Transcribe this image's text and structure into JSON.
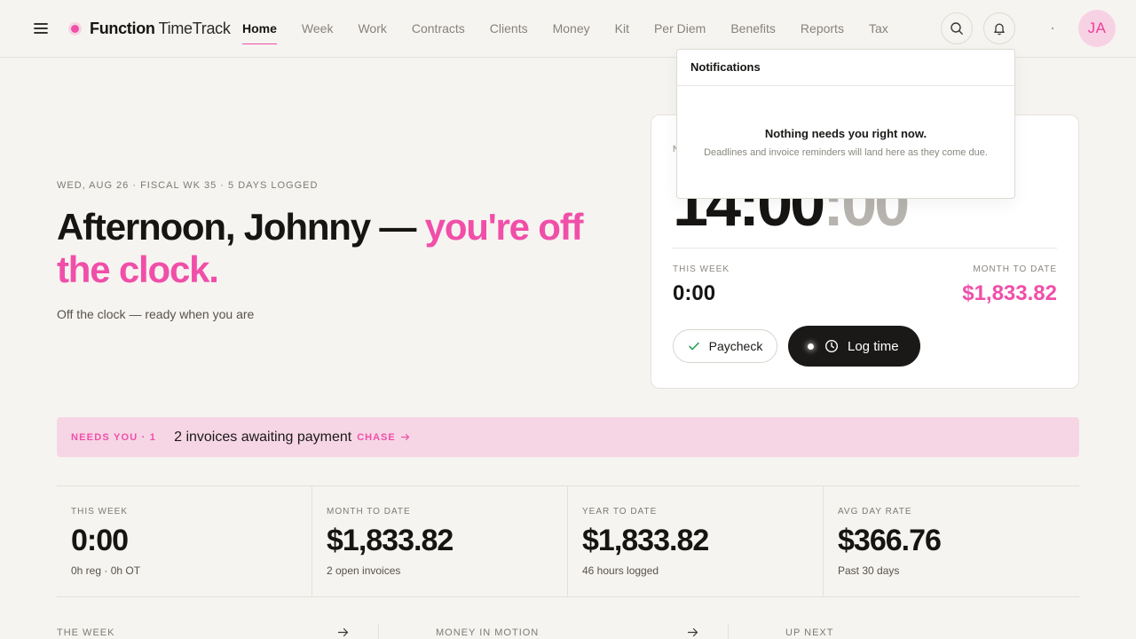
{
  "brand": {
    "name": "Function",
    "suffix": "TimeTrack",
    "accent": "#f04fa9"
  },
  "nav": [
    {
      "label": "Home",
      "active": true
    },
    {
      "label": "Week"
    },
    {
      "label": "Work"
    },
    {
      "label": "Contracts"
    },
    {
      "label": "Clients"
    },
    {
      "label": "Money"
    },
    {
      "label": "Kit"
    },
    {
      "label": "Per Diem"
    },
    {
      "label": "Benefits"
    },
    {
      "label": "Reports"
    },
    {
      "label": "Tax"
    }
  ],
  "header_icons": {
    "search": "search-icon",
    "notifications": "bell-icon",
    "menu": "hamburger-icon"
  },
  "user": {
    "initials": "JA"
  },
  "hero": {
    "date_line": "WED, AUG 26 · FISCAL WK 35 · 5 DAYS LOGGED",
    "headline_main": "Afternoon, Johnny — ",
    "headline_accent": "you're off the clock.",
    "subline": "Off the clock — ready when you are"
  },
  "timer_card": {
    "label": "N",
    "time_main": "14:00",
    "time_dim": ":00",
    "this_week_label": "THIS WEEK",
    "this_week_value": "0:00",
    "month_label": "MONTH TO DATE",
    "month_value": "$1,833.82",
    "paycheck_label": "Paycheck",
    "log_time_label": "Log time"
  },
  "notifications": {
    "title": "Notifications",
    "empty_title": "Nothing needs you right now.",
    "empty_sub": "Deadlines and invoice reminders will land here as they come due."
  },
  "needs_banner": {
    "tag": "NEEDS YOU · 1",
    "text": "2 invoices awaiting payment",
    "action": "CHASE"
  },
  "stats": [
    {
      "label": "THIS WEEK",
      "value": "0:00",
      "sub": "0h reg · 0h OT"
    },
    {
      "label": "MONTH TO DATE",
      "value": "$1,833.82",
      "sub": "2 open invoices"
    },
    {
      "label": "YEAR TO DATE",
      "value": "$1,833.82",
      "sub": "46 hours logged"
    },
    {
      "label": "AVG DAY RATE",
      "value": "$366.76",
      "sub": "Past 30 days"
    }
  ],
  "sections": [
    {
      "label": "THE WEEK"
    },
    {
      "label": "MONEY IN MOTION"
    },
    {
      "label": "UP NEXT"
    }
  ]
}
